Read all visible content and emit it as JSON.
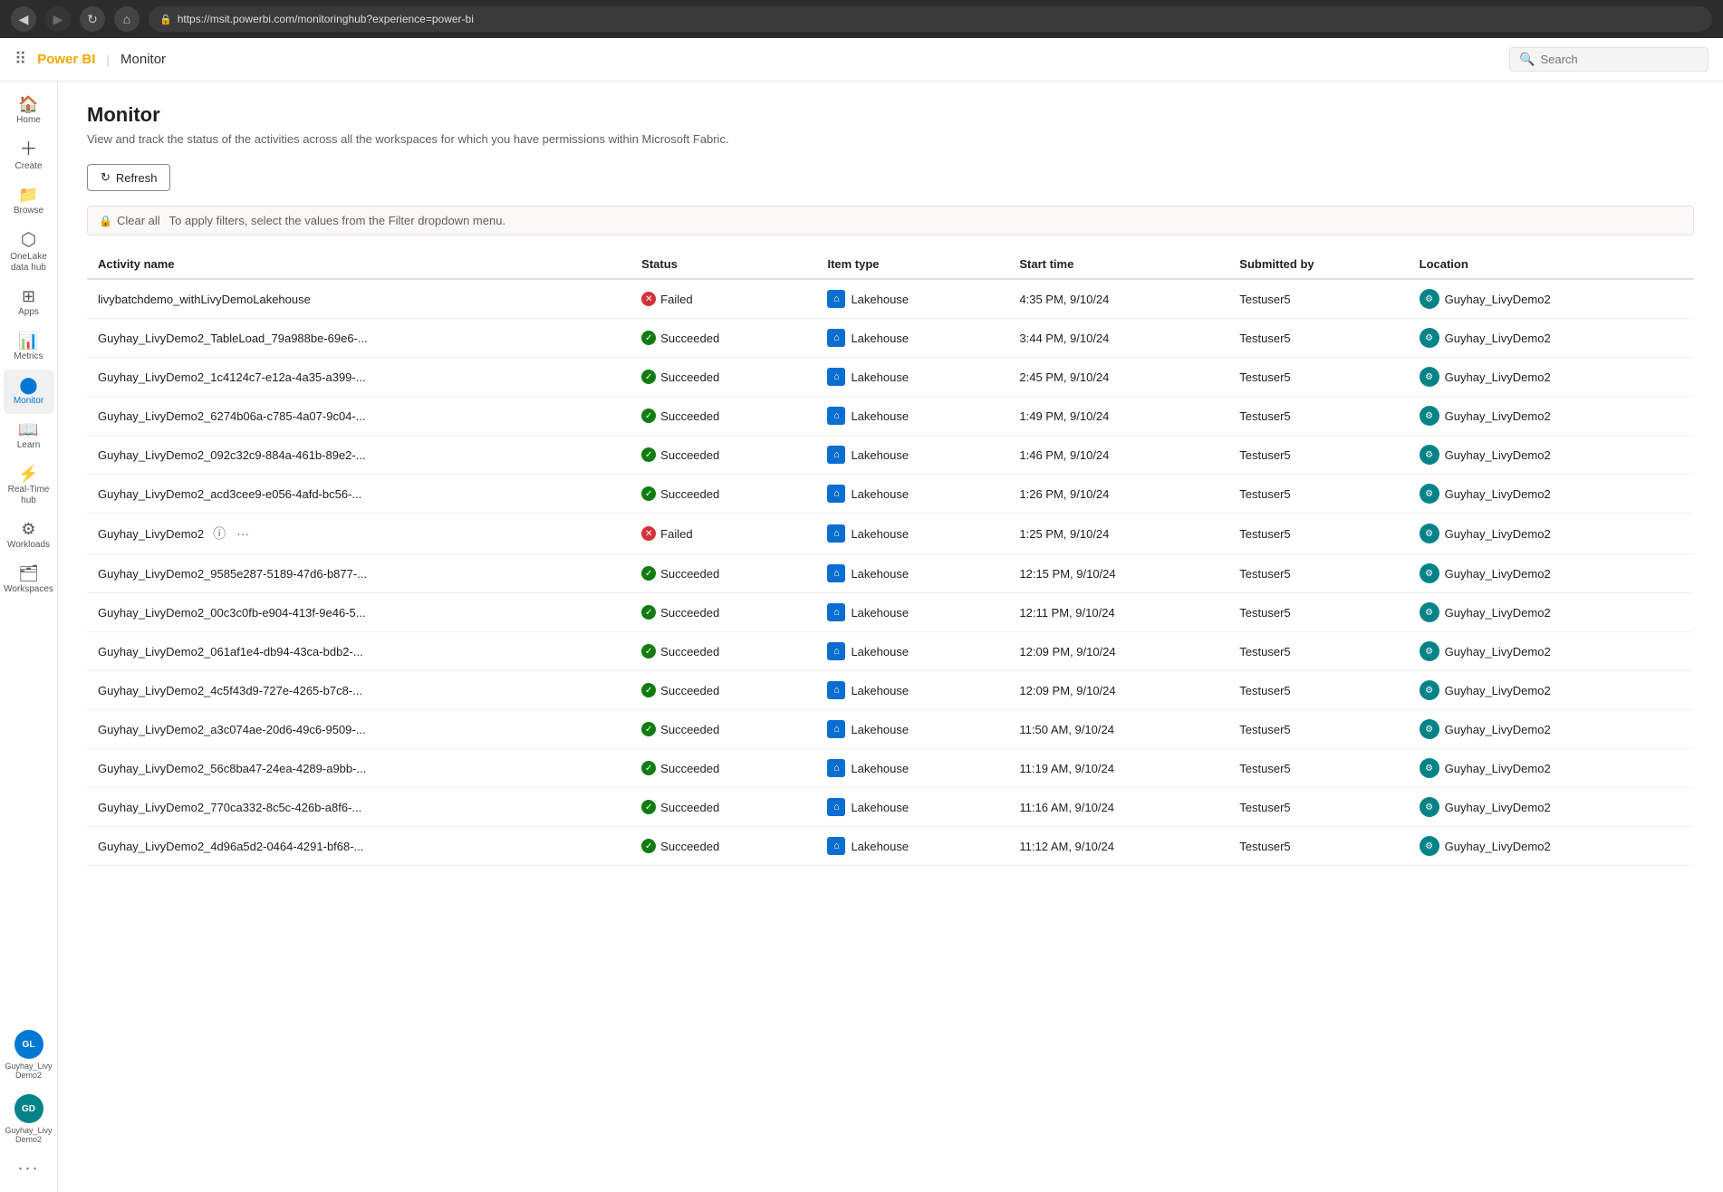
{
  "browser": {
    "url": "https://msit.powerbi.com/monitoringhub?experience=power-bi"
  },
  "topbar": {
    "brand": "Power BI",
    "separator": "|",
    "page": "Monitor",
    "search_placeholder": "Search"
  },
  "sidebar": {
    "items": [
      {
        "id": "home",
        "label": "Home",
        "icon": "🏠"
      },
      {
        "id": "create",
        "label": "Create",
        "icon": "➕"
      },
      {
        "id": "browse",
        "label": "Browse",
        "icon": "📁"
      },
      {
        "id": "onelake",
        "label": "OneLake data hub",
        "icon": "⬡"
      },
      {
        "id": "apps",
        "label": "Apps",
        "icon": "⊞"
      },
      {
        "id": "metrics",
        "label": "Metrics",
        "icon": "📊"
      },
      {
        "id": "monitor",
        "label": "Monitor",
        "icon": "●",
        "active": true
      },
      {
        "id": "learn",
        "label": "Learn",
        "icon": "📖"
      },
      {
        "id": "realtime",
        "label": "Real-Time hub",
        "icon": "⚡"
      },
      {
        "id": "workloads",
        "label": "Workloads",
        "icon": "⚙"
      },
      {
        "id": "workspaces",
        "label": "Workspaces",
        "icon": "🗂"
      }
    ],
    "bottom_items": [
      {
        "id": "guyhay1",
        "label": "Guyhay_Livy Demo2",
        "type": "avatar",
        "initials": "GL"
      },
      {
        "id": "guyhay2",
        "label": "Guyhay_Livy Demo2",
        "type": "avatar2",
        "initials": "GD"
      },
      {
        "id": "more",
        "label": "...",
        "icon": "···"
      }
    ]
  },
  "page": {
    "title": "Monitor",
    "subtitle": "View and track the status of the activities across all the workspaces for which you have permissions within Microsoft Fabric."
  },
  "toolbar": {
    "refresh_label": "Refresh"
  },
  "filter_bar": {
    "clear_all_label": "Clear all",
    "hint": "To apply filters, select the values from the Filter dropdown menu."
  },
  "table": {
    "columns": [
      {
        "id": "activity_name",
        "label": "Activity name"
      },
      {
        "id": "status",
        "label": "Status"
      },
      {
        "id": "item_type",
        "label": "Item type"
      },
      {
        "id": "start_time",
        "label": "Start time"
      },
      {
        "id": "submitted_by",
        "label": "Submitted by"
      },
      {
        "id": "location",
        "label": "Location"
      }
    ],
    "rows": [
      {
        "activity": "livybatchdemo_withLivyDemoLakehouse",
        "status": "Failed",
        "status_type": "failed",
        "item_type": "Lakehouse",
        "start_time": "4:35 PM, 9/10/24",
        "submitted_by": "Testuser5",
        "location": "Guyhay_LivyDemo2",
        "has_actions": false
      },
      {
        "activity": "Guyhay_LivyDemo2_TableLoad_79a988be-69e6-...",
        "status": "Succeeded",
        "status_type": "success",
        "item_type": "Lakehouse",
        "start_time": "3:44 PM, 9/10/24",
        "submitted_by": "Testuser5",
        "location": "Guyhay_LivyDemo2",
        "has_actions": false
      },
      {
        "activity": "Guyhay_LivyDemo2_1c4124c7-e12a-4a35-a399-...",
        "status": "Succeeded",
        "status_type": "success",
        "item_type": "Lakehouse",
        "start_time": "2:45 PM, 9/10/24",
        "submitted_by": "Testuser5",
        "location": "Guyhay_LivyDemo2",
        "has_actions": false
      },
      {
        "activity": "Guyhay_LivyDemo2_6274b06a-c785-4a07-9c04-...",
        "status": "Succeeded",
        "status_type": "success",
        "item_type": "Lakehouse",
        "start_time": "1:49 PM, 9/10/24",
        "submitted_by": "Testuser5",
        "location": "Guyhay_LivyDemo2",
        "has_actions": false
      },
      {
        "activity": "Guyhay_LivyDemo2_092c32c9-884a-461b-89e2-...",
        "status": "Succeeded",
        "status_type": "success",
        "item_type": "Lakehouse",
        "start_time": "1:46 PM, 9/10/24",
        "submitted_by": "Testuser5",
        "location": "Guyhay_LivyDemo2",
        "has_actions": false
      },
      {
        "activity": "Guyhay_LivyDemo2_acd3cee9-e056-4afd-bc56-...",
        "status": "Succeeded",
        "status_type": "success",
        "item_type": "Lakehouse",
        "start_time": "1:26 PM, 9/10/24",
        "submitted_by": "Testuser5",
        "location": "Guyhay_LivyDemo2",
        "has_actions": false
      },
      {
        "activity": "Guyhay_LivyDemo2",
        "status": "Failed",
        "status_type": "failed",
        "item_type": "Lakehouse",
        "start_time": "1:25 PM, 9/10/24",
        "submitted_by": "Testuser5",
        "location": "Guyhay_LivyDemo2",
        "has_actions": true
      },
      {
        "activity": "Guyhay_LivyDemo2_9585e287-5189-47d6-b877-...",
        "status": "Succeeded",
        "status_type": "success",
        "item_type": "Lakehouse",
        "start_time": "12:15 PM, 9/10/24",
        "submitted_by": "Testuser5",
        "location": "Guyhay_LivyDemo2",
        "has_actions": false
      },
      {
        "activity": "Guyhay_LivyDemo2_00c3c0fb-e904-413f-9e46-5...",
        "status": "Succeeded",
        "status_type": "success",
        "item_type": "Lakehouse",
        "start_time": "12:11 PM, 9/10/24",
        "submitted_by": "Testuser5",
        "location": "Guyhay_LivyDemo2",
        "has_actions": false
      },
      {
        "activity": "Guyhay_LivyDemo2_061af1e4-db94-43ca-bdb2-...",
        "status": "Succeeded",
        "status_type": "success",
        "item_type": "Lakehouse",
        "start_time": "12:09 PM, 9/10/24",
        "submitted_by": "Testuser5",
        "location": "Guyhay_LivyDemo2",
        "has_actions": false
      },
      {
        "activity": "Guyhay_LivyDemo2_4c5f43d9-727e-4265-b7c8-...",
        "status": "Succeeded",
        "status_type": "success",
        "item_type": "Lakehouse",
        "start_time": "12:09 PM, 9/10/24",
        "submitted_by": "Testuser5",
        "location": "Guyhay_LivyDemo2",
        "has_actions": false
      },
      {
        "activity": "Guyhay_LivyDemo2_a3c074ae-20d6-49c6-9509-...",
        "status": "Succeeded",
        "status_type": "success",
        "item_type": "Lakehouse",
        "start_time": "11:50 AM, 9/10/24",
        "submitted_by": "Testuser5",
        "location": "Guyhay_LivyDemo2",
        "has_actions": false
      },
      {
        "activity": "Guyhay_LivyDemo2_56c8ba47-24ea-4289-a9bb-...",
        "status": "Succeeded",
        "status_type": "success",
        "item_type": "Lakehouse",
        "start_time": "11:19 AM, 9/10/24",
        "submitted_by": "Testuser5",
        "location": "Guyhay_LivyDemo2",
        "has_actions": false
      },
      {
        "activity": "Guyhay_LivyDemo2_770ca332-8c5c-426b-a8f6-...",
        "status": "Succeeded",
        "status_type": "success",
        "item_type": "Lakehouse",
        "start_time": "11:16 AM, 9/10/24",
        "submitted_by": "Testuser5",
        "location": "Guyhay_LivyDemo2",
        "has_actions": false
      },
      {
        "activity": "Guyhay_LivyDemo2_4d96a5d2-0464-4291-bf68-...",
        "status": "Succeeded",
        "status_type": "success",
        "item_type": "Lakehouse",
        "start_time": "11:12 AM, 9/10/24",
        "submitted_by": "Testuser5",
        "location": "Guyhay_LivyDemo2",
        "has_actions": false
      }
    ]
  },
  "icons": {
    "refresh": "↻",
    "clear": "🔒",
    "search": "🔍",
    "waffle": "⠿",
    "info": "ⓘ",
    "more": "···",
    "lock": "🔒"
  }
}
